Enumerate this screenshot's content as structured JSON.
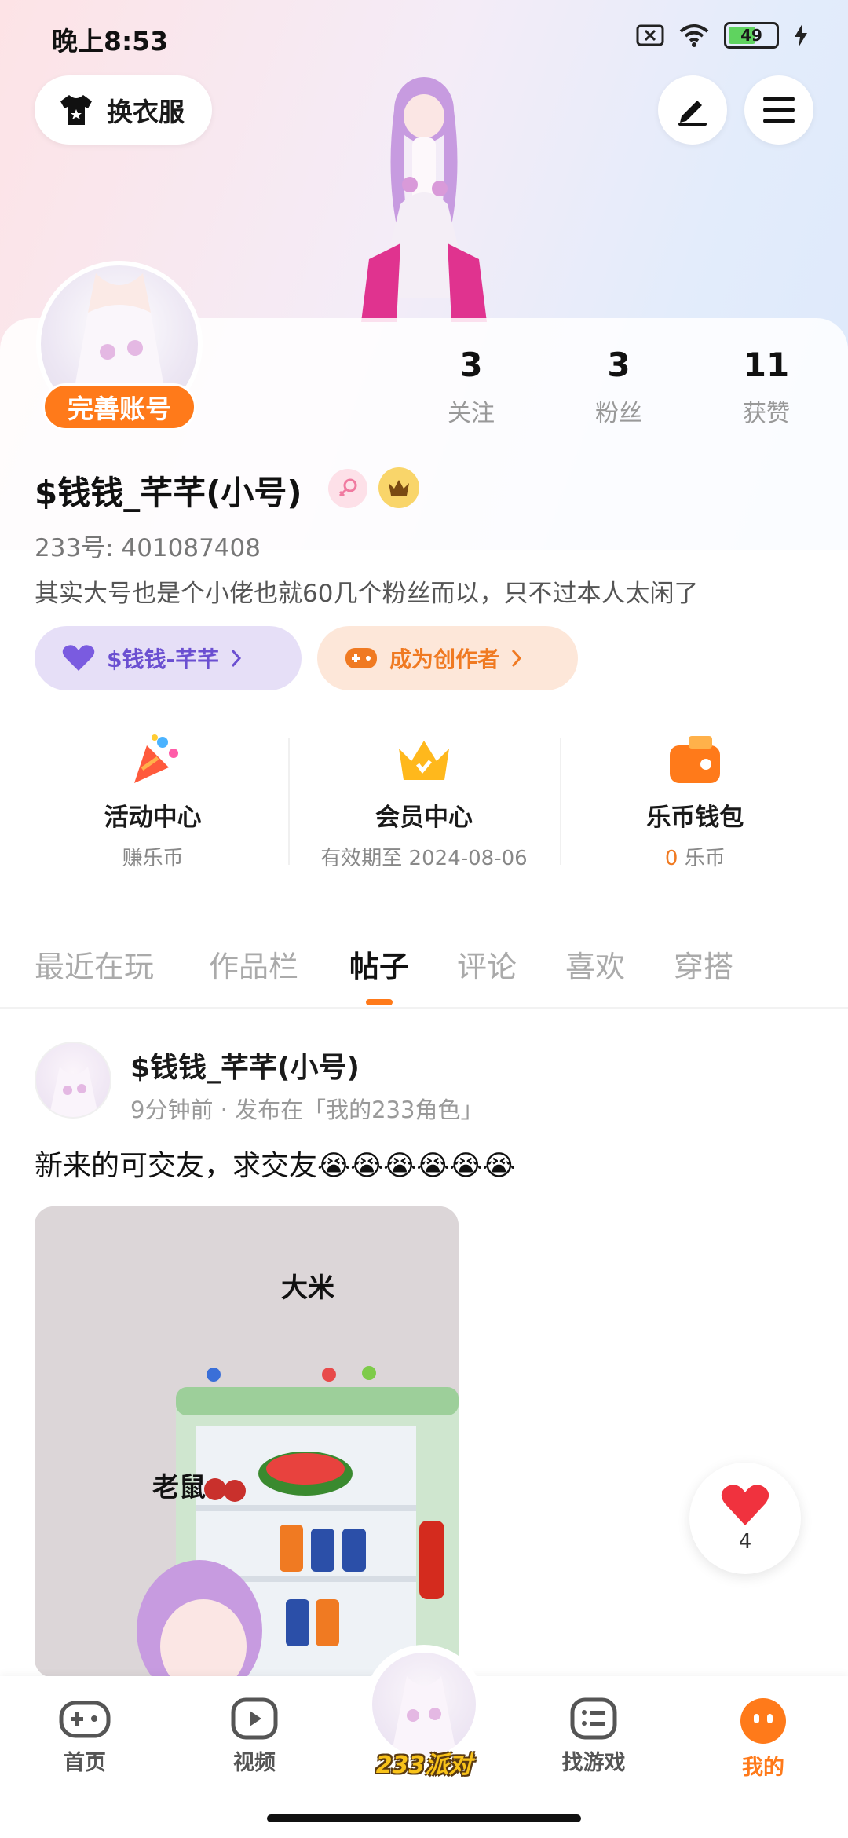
{
  "status_bar": {
    "time": "晚上8:53",
    "battery": "49"
  },
  "header": {
    "dress_label": "换衣服"
  },
  "profile": {
    "complete_account": "完善账号",
    "stats": [
      {
        "num": "3",
        "label": "关注"
      },
      {
        "num": "3",
        "label": "粉丝"
      },
      {
        "num": "11",
        "label": "获赞"
      }
    ],
    "nickname": "$钱钱_芊芊(小号)",
    "uid": "233号: 401087408",
    "bio": "其实大号也是个小佬也就60几个粉丝而以，只不过本人太闲了",
    "fan_pill": "$钱钱-芊芊",
    "creator_pill": "成为创作者"
  },
  "services": [
    {
      "title": "活动中心",
      "sub": "赚乐币"
    },
    {
      "title": "会员中心",
      "sub": "有效期至 2024-08-06"
    },
    {
      "title": "乐币钱包",
      "sub_num": "0",
      "sub": "乐币"
    }
  ],
  "tabs": [
    "最近在玩",
    "作品栏",
    "帖子",
    "评论",
    "喜欢",
    "穿搭"
  ],
  "active_tab": "帖子",
  "post": {
    "author": "$钱钱_芊芊(小号)",
    "meta": "9分钟前 · 发布在「我的233角色」",
    "text": "新来的可交友，求交友😭😭😭😭😭😭",
    "image_labels": {
      "top": "大米",
      "left": "老鼠"
    },
    "likes": "4"
  },
  "nav": {
    "home": "首页",
    "video": "视频",
    "party": "233派对",
    "games": "找游戏",
    "mine": "我的"
  },
  "colors": {
    "accent": "#ff7a1a",
    "purple": "#6b4fd1"
  }
}
